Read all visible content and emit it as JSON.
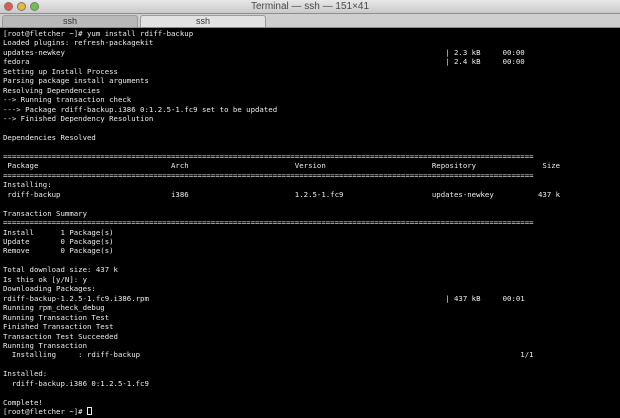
{
  "window": {
    "title": "Terminal — ssh — 151×41"
  },
  "tabs": [
    {
      "label": "ssh",
      "active": false
    },
    {
      "label": "ssh",
      "active": true
    }
  ],
  "terminal": {
    "lines": [
      "[root@fletcher ~]# yum install rdiff-backup",
      "Loaded plugins: refresh-packagekit",
      "updates-newkey                                                                                      | 2.3 kB     00:00",
      "fedora                                                                                              | 2.4 kB     00:00",
      "Setting up Install Process",
      "Parsing package install arguments",
      "Resolving Dependencies",
      "--> Running transaction check",
      "---> Package rdiff-backup.i386 0:1.2.5-1.fc9 set to be updated",
      "--> Finished Dependency Resolution",
      "",
      "Dependencies Resolved",
      "",
      "========================================================================================================================",
      " Package                              Arch                        Version                        Repository               Size",
      "========================================================================================================================",
      "Installing:",
      " rdiff-backup                         i386                        1.2.5-1.fc9                    updates-newkey          437 k",
      "",
      "Transaction Summary",
      "========================================================================================================================",
      "Install      1 Package(s)",
      "Update       0 Package(s)",
      "Remove       0 Package(s)",
      "",
      "Total download size: 437 k",
      "Is this ok [y/N]: y",
      "Downloading Packages:",
      "rdiff-backup-1.2.5-1.fc9.i386.rpm                                                                   | 437 kB     00:01",
      "Running rpm_check_debug",
      "Running Transaction Test",
      "Finished Transaction Test",
      "Transaction Test Succeeded",
      "Running Transaction",
      "  Installing     : rdiff-backup                                                                                      1/1",
      "",
      "Installed:",
      "  rdiff-backup.i386 0:1.2.5-1.fc9",
      "",
      "Complete!",
      "[root@fletcher ~]# "
    ]
  },
  "colors": {
    "background": "#000000",
    "foreground": "#ececec"
  }
}
